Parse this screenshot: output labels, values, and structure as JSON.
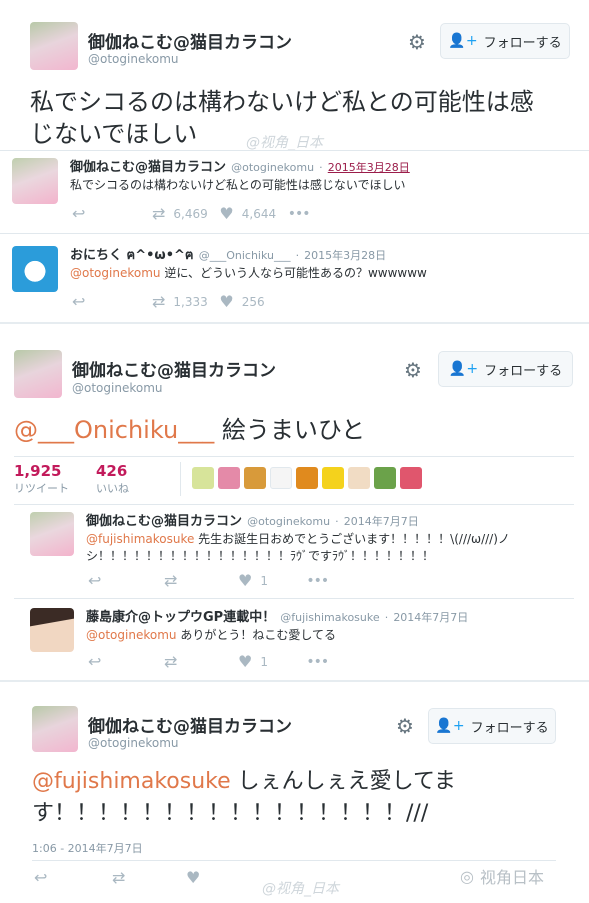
{
  "profile": {
    "name": "御伽ねこむ@猫目カラコン",
    "handle": "@otoginekomu",
    "follow_label": "フォローする"
  },
  "card1": {
    "text_line1": "私でシコるのは構わないけど私との可能性は感",
    "text_line2": "じないでほしい"
  },
  "embed1": {
    "name": "御伽ねこむ@猫目カラコン",
    "handle": "@otoginekomu",
    "date": "2015年3月28日",
    "text": "私でシコるのは構わないけど私との可能性は感じないでほしい",
    "retweets": "6,469",
    "likes": "4,644"
  },
  "embed2": {
    "name": "おにちく ฅ^•ω•^ฅ",
    "handle": "@___Onichiku___",
    "date": "2015年3月28日",
    "mention": "@otoginekomu",
    "text": " 逆に、どういう人なら可能性あるの？wwwwww",
    "retweets": "1,333",
    "likes": "256"
  },
  "card2": {
    "mention": "@___Onichiku___",
    "text": " 絵うまいひと",
    "retweet_count": "1,925",
    "retweet_label": "リツイート",
    "like_count": "426",
    "like_label": "いいね"
  },
  "embed3": {
    "name": "御伽ねこむ@猫目カラコン",
    "handle": "@otoginekomu",
    "date": "2014年7月7日",
    "mention": "@fujishimakosuke",
    "text1": " 先生お誕生日おめでとうございます！！！！！\\(///ω///)ノ",
    "text2": "シ！！！！！！！！！！！！！！！！ﾗｳﾞですﾗｳﾞ！！！！！！！",
    "likes": "1"
  },
  "embed4": {
    "name": "藤島康介@トップウGP連載中！",
    "handle": "@fujishimakosuke",
    "date": "2014年7月7日",
    "mention": "@otoginekomu",
    "text": " ありがとう！ねこむ愛してる",
    "likes": "1"
  },
  "card3": {
    "mention": "@fujishimakosuke",
    "text1": " しぇんしぇえ愛してま",
    "text2": "す！！！！！！！！！！！！！！！！///",
    "timestamp": "1:06 - 2014年7月7日"
  },
  "watermarks": {
    "inline": "@视角_日本",
    "corner": "视角日本"
  },
  "colors": {
    "mention": "#e0784a",
    "link_date": "#9b1d4a",
    "icon_gray": "#aab8c2"
  }
}
